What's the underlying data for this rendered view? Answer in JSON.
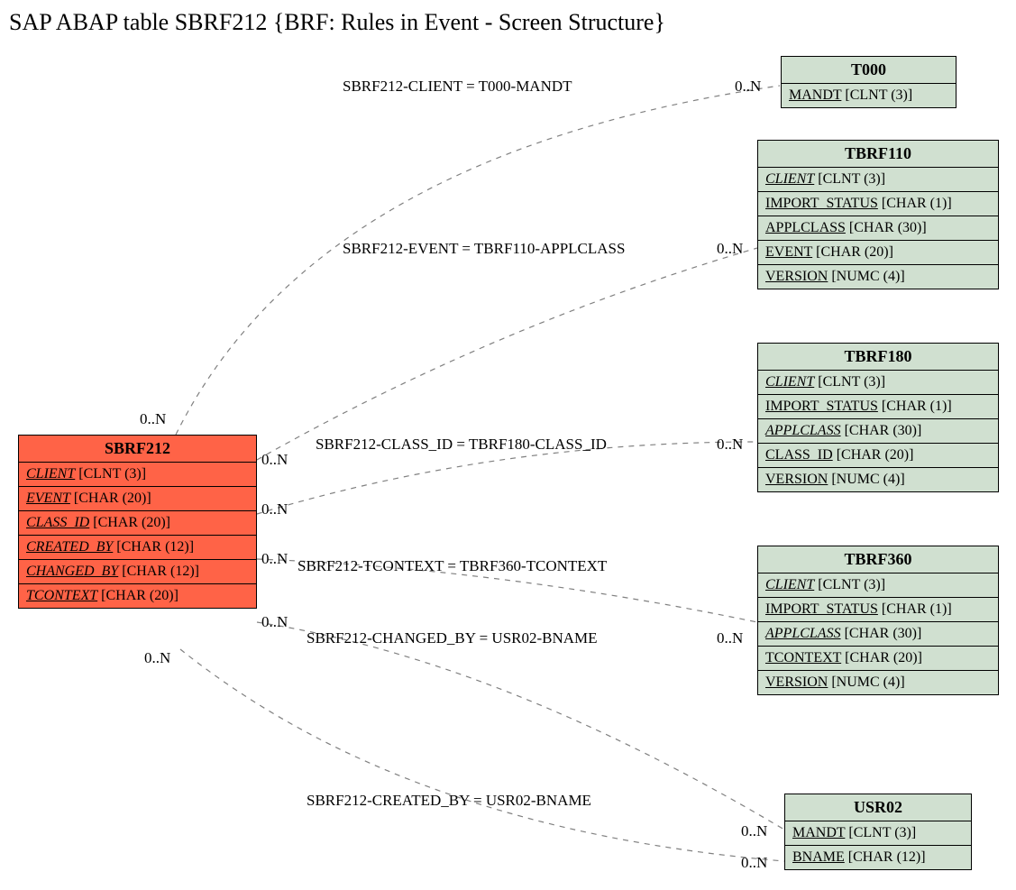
{
  "title": "SAP ABAP table SBRF212 {BRF: Rules in Event - Screen Structure}",
  "entities": {
    "sbrf212": {
      "name": "SBRF212",
      "rows": [
        {
          "field": "CLIENT",
          "type": "[CLNT (3)]",
          "fk": true
        },
        {
          "field": "EVENT",
          "type": "[CHAR (20)]",
          "fk": true
        },
        {
          "field": "CLASS_ID",
          "type": "[CHAR (20)]",
          "fk": true
        },
        {
          "field": "CREATED_BY",
          "type": "[CHAR (12)]",
          "fk": true
        },
        {
          "field": "CHANGED_BY",
          "type": "[CHAR (12)]",
          "fk": true
        },
        {
          "field": "TCONTEXT",
          "type": "[CHAR (20)]",
          "fk": true
        }
      ]
    },
    "t000": {
      "name": "T000",
      "rows": [
        {
          "field": "MANDT",
          "type": "[CLNT (3)]",
          "pk": true
        }
      ]
    },
    "tbrf110": {
      "name": "TBRF110",
      "rows": [
        {
          "field": "CLIENT",
          "type": "[CLNT (3)]",
          "fk": true,
          "pk": true
        },
        {
          "field": "IMPORT_STATUS",
          "type": "[CHAR (1)]",
          "pk": true
        },
        {
          "field": "APPLCLASS",
          "type": "[CHAR (30)]",
          "pk": true
        },
        {
          "field": "EVENT",
          "type": "[CHAR (20)]",
          "pk": true
        },
        {
          "field": "VERSION",
          "type": "[NUMC (4)]",
          "pk": true
        }
      ]
    },
    "tbrf180": {
      "name": "TBRF180",
      "rows": [
        {
          "field": "CLIENT",
          "type": "[CLNT (3)]",
          "fk": true,
          "pk": true
        },
        {
          "field": "IMPORT_STATUS",
          "type": "[CHAR (1)]",
          "pk": true
        },
        {
          "field": "APPLCLASS",
          "type": "[CHAR (30)]",
          "fk": true,
          "pk": true
        },
        {
          "field": "CLASS_ID",
          "type": "[CHAR (20)]",
          "pk": true
        },
        {
          "field": "VERSION",
          "type": "[NUMC (4)]",
          "pk": true
        }
      ]
    },
    "tbrf360": {
      "name": "TBRF360",
      "rows": [
        {
          "field": "CLIENT",
          "type": "[CLNT (3)]",
          "fk": true,
          "pk": true
        },
        {
          "field": "IMPORT_STATUS",
          "type": "[CHAR (1)]",
          "pk": true
        },
        {
          "field": "APPLCLASS",
          "type": "[CHAR (30)]",
          "fk": true,
          "pk": true
        },
        {
          "field": "TCONTEXT",
          "type": "[CHAR (20)]",
          "pk": true
        },
        {
          "field": "VERSION",
          "type": "[NUMC (4)]",
          "pk": true
        }
      ]
    },
    "usr02": {
      "name": "USR02",
      "rows": [
        {
          "field": "MANDT",
          "type": "[CLNT (3)]",
          "pk": true
        },
        {
          "field": "BNAME",
          "type": "[CHAR (12)]",
          "pk": true
        }
      ]
    }
  },
  "relations": {
    "r1": {
      "label": "SBRF212-CLIENT = T000-MANDT",
      "left": "0..N",
      "right": "0..N"
    },
    "r2": {
      "label": "SBRF212-EVENT = TBRF110-APPLCLASS",
      "left": "0..N",
      "right": "0..N"
    },
    "r3": {
      "label": "SBRF212-CLASS_ID = TBRF180-CLASS_ID",
      "left": "0..N",
      "right": "0..N"
    },
    "r4": {
      "label": "SBRF212-TCONTEXT = TBRF360-TCONTEXT",
      "left": "0..N",
      "right": "0..N"
    },
    "r5": {
      "label": "SBRF212-CHANGED_BY = USR02-BNAME",
      "left": "0..N",
      "right": "0..N"
    },
    "r6": {
      "label": "SBRF212-CREATED_BY = USR02-BNAME",
      "left": "0..N",
      "right": "0..N"
    }
  }
}
